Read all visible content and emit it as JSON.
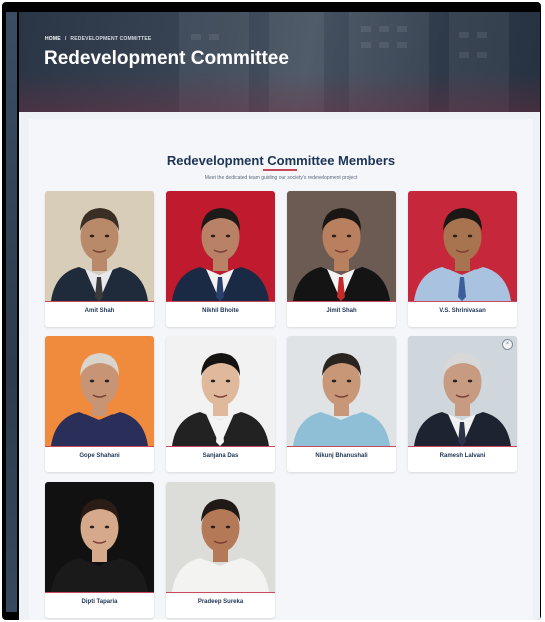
{
  "breadcrumb": {
    "home": "HOME",
    "separator": "/",
    "current": "REDEVELOPMENT COMMITTEE"
  },
  "hero": {
    "title": "Redevelopment Committee"
  },
  "section": {
    "title": "Redevelopment Committee Members",
    "subtitle": "Meet the dedicated team guiding our society's redevelopment project"
  },
  "members": [
    {
      "name": "Amit Shah",
      "bg": "#d8cdb8",
      "skin": "#b98a6a",
      "hair": "#3b2e25",
      "shirt": "#e6e8ec",
      "coat": "#1f2a3a",
      "tie": "#3a3a3a"
    },
    {
      "name": "Nikhil Bhoite",
      "bg": "#c01a2e",
      "skin": "#b98266",
      "hair": "#1e1a18",
      "shirt": "#f2f2f2",
      "coat": "#1b2a44",
      "tie": "#2a3f6e"
    },
    {
      "name": "Jimit Shah",
      "bg": "#6b5b52",
      "skin": "#b98060",
      "hair": "#1b1613",
      "shirt": "#f4f4f4",
      "coat": "#141414",
      "tie": "#c32a2a"
    },
    {
      "name": "V.S. Shrinivasan",
      "bg": "#c7273a",
      "skin": "#a8744f",
      "hair": "#1a1714",
      "shirt": "#a9c2e0",
      "coat": "#a9c2e0",
      "tie": "#3a5f9b"
    },
    {
      "name": "Gope Shahani",
      "bg": "#f08a3c",
      "skin": "#c89476",
      "hair": "#d9d4cc",
      "shirt": "#2a2f5a",
      "coat": "#2a2f5a",
      "tie": "#2a2f5a"
    },
    {
      "name": "Sanjana Das",
      "bg": "#f2f2f2",
      "skin": "#e0b99c",
      "hair": "#151212",
      "shirt": "#f4f4f4",
      "coat": "#222222",
      "tie": "#f4f4f4"
    },
    {
      "name": "Nikunj Bhanushali",
      "bg": "#dfe3e6",
      "skin": "#c79777",
      "hair": "#2a2420",
      "shirt": "#8fbfd6",
      "coat": "#8fbfd6",
      "tie": "#8fbfd6"
    },
    {
      "name": "Ramesh Lalvani",
      "bg": "#cfd6dc",
      "skin": "#c79a82",
      "hair": "#d8d8d8",
      "shirt": "#f1f1f1",
      "coat": "#1d2330",
      "tie": "#2c3346"
    },
    {
      "name": "Dipti Taparia",
      "bg": "#111111",
      "skin": "#d7a98b",
      "hair": "#2b1d15",
      "shirt": "#1a1a1a",
      "coat": "#1a1a1a",
      "tie": "#1a1a1a"
    },
    {
      "name": "Pradeep Sureka",
      "bg": "#dcdcd8",
      "skin": "#b47a58",
      "hair": "#1f1a16",
      "shirt": "#f3f3f1",
      "coat": "#f3f3f1",
      "tie": "#f3f3f1"
    }
  ],
  "ad_close_icon": "close-circle-icon",
  "colors": {
    "accent": "#c8475b",
    "heading": "#1d3456"
  }
}
